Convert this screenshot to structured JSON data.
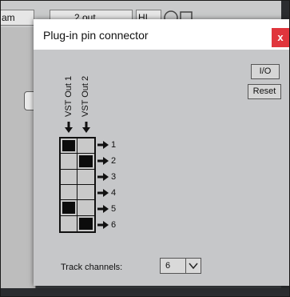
{
  "background": {
    "tabs": [
      {
        "label": "am"
      },
      {
        "label": "2 out"
      },
      {
        "label": "HI"
      }
    ]
  },
  "dialog": {
    "title": "Plug-in pin connector",
    "close_label": "x",
    "io_label": "I/O",
    "reset_label": "Reset",
    "inputs": [
      {
        "label": "VST Out 1"
      },
      {
        "label": "VST Out 2"
      }
    ],
    "outputs": [
      "1",
      "2",
      "3",
      "4",
      "5",
      "6"
    ],
    "pin_matrix": [
      [
        true,
        false
      ],
      [
        false,
        true
      ],
      [
        false,
        false
      ],
      [
        false,
        false
      ],
      [
        true,
        false
      ],
      [
        false,
        true
      ]
    ],
    "track_channels_label": "Track channels:",
    "track_channels_value": "6"
  },
  "colors": {
    "close_button": "#e0353c",
    "dialog_bg": "#c6c7c9",
    "pin_on": "#0c0c0c"
  }
}
